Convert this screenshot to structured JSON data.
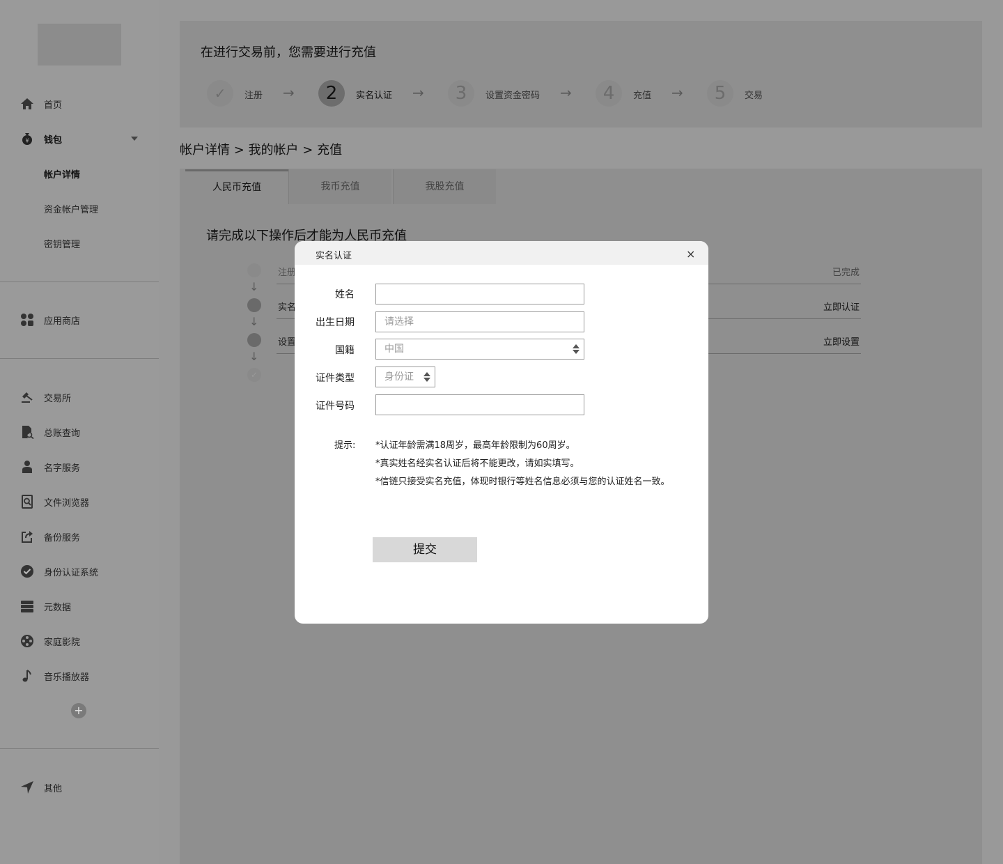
{
  "sidebar": {
    "items": [
      {
        "label": "首页",
        "icon": "home-icon"
      },
      {
        "label": "钱包",
        "icon": "wallet-icon"
      },
      {
        "label": "应用商店",
        "icon": "app-store-icon"
      },
      {
        "label": "交易所",
        "icon": "exchange-icon"
      },
      {
        "label": "总账查询",
        "icon": "ledger-search-icon"
      },
      {
        "label": "名字服务",
        "icon": "user-icon"
      },
      {
        "label": "文件浏览器",
        "icon": "file-browser-icon"
      },
      {
        "label": "备份服务",
        "icon": "backup-icon"
      },
      {
        "label": "身份认证系统",
        "icon": "verified-icon"
      },
      {
        "label": "元数据",
        "icon": "database-icon"
      },
      {
        "label": "家庭影院",
        "icon": "film-reel-icon"
      },
      {
        "label": "音乐播放器",
        "icon": "music-note-icon"
      },
      {
        "label": "其他",
        "icon": "navigation-arrow-icon"
      }
    ],
    "wallet_sub": [
      "帐户详情",
      "资金帐户管理",
      "密钥管理"
    ],
    "add_label": "+"
  },
  "steps_panel": {
    "title": "在进行交易前，您需要进行充值",
    "steps": [
      {
        "number": "✓",
        "label": "注册"
      },
      {
        "number": "2",
        "label": "实名认证"
      },
      {
        "number": "3",
        "label": "设置资金密码"
      },
      {
        "number": "4",
        "label": "充值"
      },
      {
        "number": "5",
        "label": "交易"
      }
    ],
    "active_step": 2
  },
  "breadcrumb": {
    "items": [
      "帐户详情",
      "我的帐户",
      "充值"
    ],
    "separator": ">"
  },
  "tabs": [
    "人民币充值",
    "我币充值",
    "我股充值"
  ],
  "content": {
    "title": "请完成以下操作后才能为人民币充值",
    "tasks": [
      {
        "name": "注册",
        "status": "已完成"
      },
      {
        "name": "实名",
        "status": "立即认证"
      },
      {
        "name": "设置",
        "status": "立即设置"
      }
    ]
  },
  "modal": {
    "title": "实名认证",
    "close": "×",
    "fields": {
      "name_label": "姓名",
      "birth_label": "出生日期",
      "birth_placeholder": "请选择",
      "nationality_label": "国籍",
      "nationality_value": "中国",
      "id_type_label": "证件类型",
      "id_type_value": "身份证",
      "id_number_label": "证件号码"
    },
    "tip_label": "提示:",
    "tips": [
      "*认证年龄需满18周岁，最高年龄限制为60周岁。",
      "*真实姓名经实名认证后将不能更改，请如实填写。",
      "*信链只接受实名充值，体现时银行等姓名信息必须与您的认证姓名一致。"
    ],
    "submit_label": "提交"
  },
  "colors": {
    "overlay_bg": "#999999",
    "modal_bg": "#ffffff",
    "button_bg": "#d8d8d8"
  }
}
